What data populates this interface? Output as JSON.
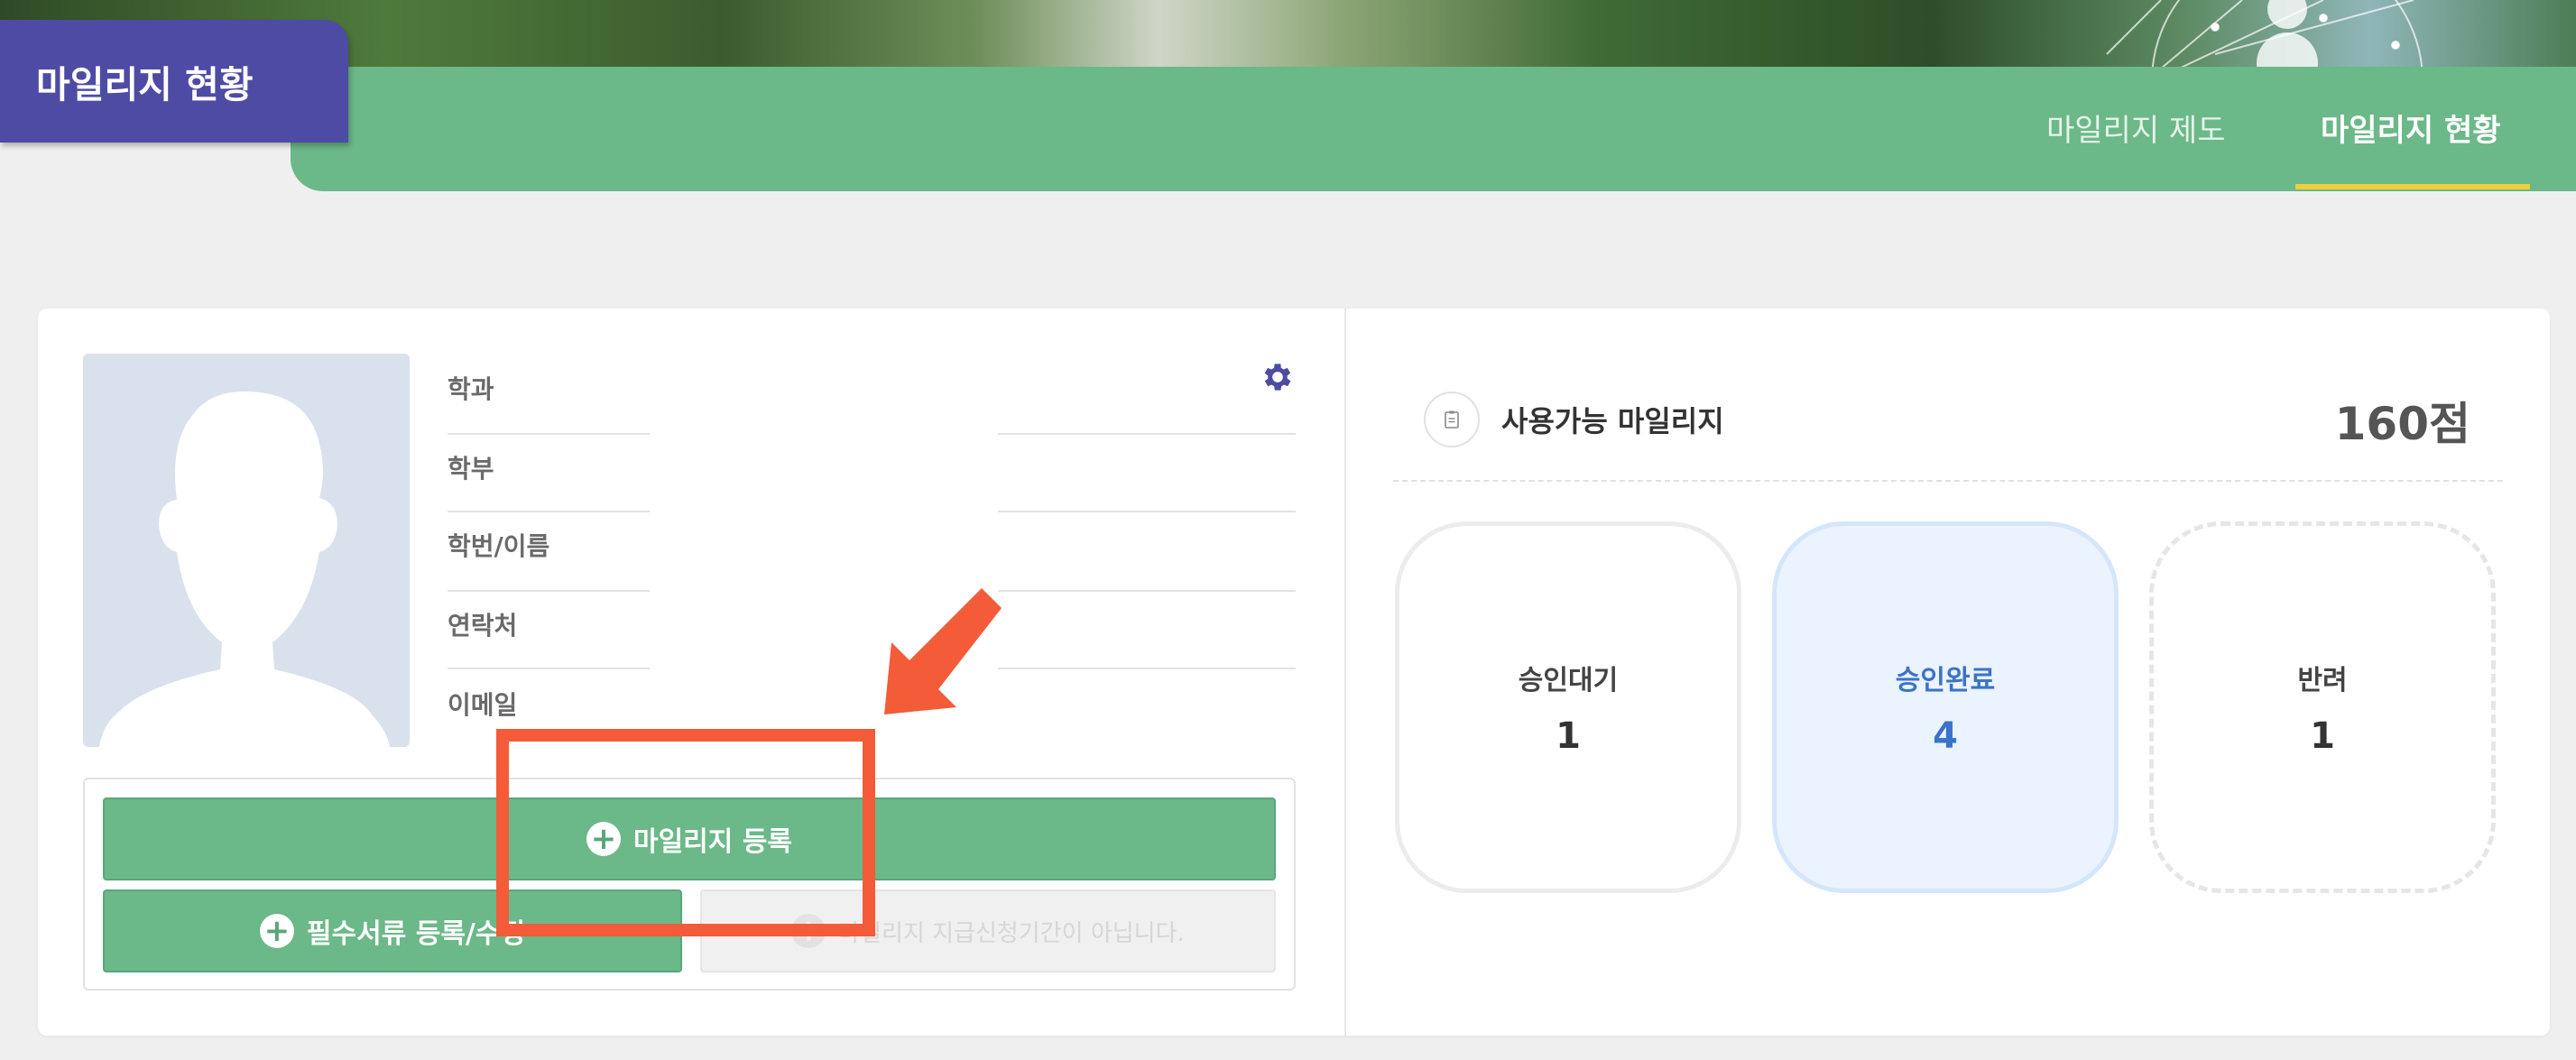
{
  "header": {
    "brand_title": "마일리지 현황",
    "nav": [
      {
        "label": "마일리지 제도",
        "active": false
      },
      {
        "label": "마일리지 현황",
        "active": true
      }
    ],
    "accent_color": "#6bb888",
    "brand_color": "#4e4ba4",
    "underline_color": "#f0cf3a"
  },
  "profile": {
    "fields": [
      {
        "label": "학과",
        "value": ""
      },
      {
        "label": "학부",
        "value": ""
      },
      {
        "label": "학번/이름",
        "value": ""
      },
      {
        "label": "연락처",
        "value": ""
      },
      {
        "label": "이메일",
        "value": ""
      }
    ],
    "settings_icon": "gear-icon"
  },
  "actions": {
    "register_label": "마일리지 등록",
    "documents_label": "필수서류 등록/수정",
    "disabled_label": "마일리지 지급신청기간이 아닙니다."
  },
  "summary": {
    "available_label": "사용가능 마일리지",
    "available_value": "160점",
    "statuses": [
      {
        "label": "승인대기",
        "count": "1"
      },
      {
        "label": "승인완료",
        "count": "4"
      },
      {
        "label": "반려",
        "count": "1"
      }
    ]
  },
  "annotation": {
    "color": "#f35b39"
  }
}
